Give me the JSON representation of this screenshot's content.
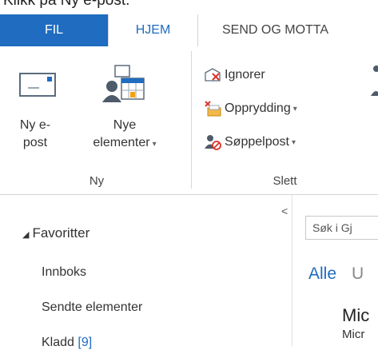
{
  "caption": "Klikk på Ny e-post:",
  "tabs": [
    {
      "label": "FIL"
    },
    {
      "label": "HJEM"
    },
    {
      "label": "SEND OG MOTTA"
    }
  ],
  "ribbon": {
    "new_email_line1": "Ny e-",
    "new_email_line2": "post",
    "new_items_line1": "Nye",
    "new_items_line2": "elementer",
    "group_ny": "Ny",
    "ignore": "Ignorer",
    "cleanup": "Opprydding",
    "junk": "Søppelpost",
    "group_slett": "Slett",
    "caret": "▾"
  },
  "nav": {
    "favorites": "Favoritter",
    "inbox": "Innboks",
    "sent": "Sendte elementer",
    "drafts": "Kladd",
    "drafts_count": "[9]"
  },
  "search_placeholder": "Søk i Gj",
  "filters": {
    "all": "Alle",
    "next": "U"
  },
  "preview": {
    "from": "Mic",
    "subject": "Micr"
  },
  "colors": {
    "accent": "#1f6cc0"
  }
}
